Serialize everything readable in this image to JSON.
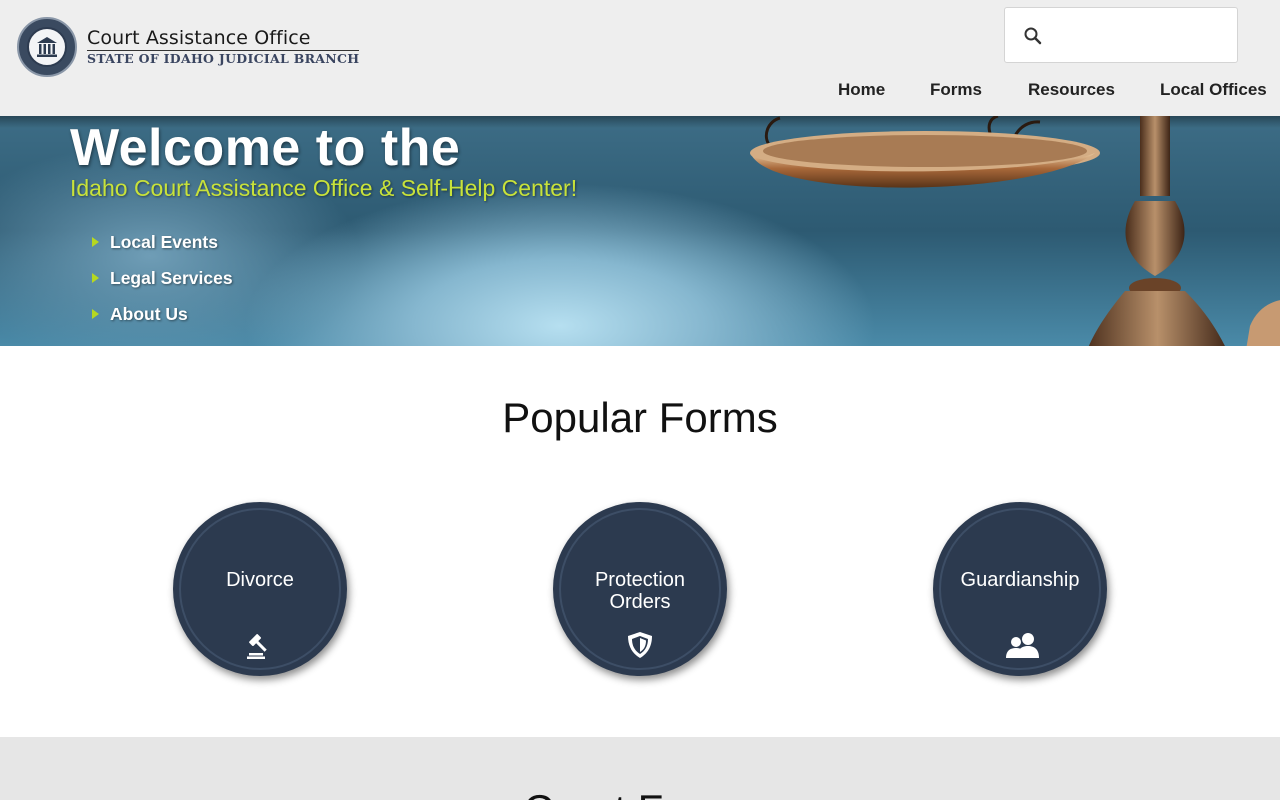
{
  "header": {
    "logo_title": "Court Assistance Office",
    "logo_subtitle": "STATE OF IDAHO JUDICIAL BRANCH",
    "search_placeholder": "",
    "nav": [
      {
        "label": "Home"
      },
      {
        "label": "Forms"
      },
      {
        "label": "Resources"
      },
      {
        "label": "Local Offices"
      }
    ]
  },
  "hero": {
    "title": "Welcome to the",
    "subtitle": "Idaho Court Assistance Office & Self-Help Center!",
    "links": [
      {
        "label": "Local Events"
      },
      {
        "label": "Legal Services"
      },
      {
        "label": "About Us"
      }
    ]
  },
  "popular": {
    "title": "Popular Forms",
    "items": [
      {
        "label": "Divorce",
        "icon": "gavel-icon"
      },
      {
        "label": "Protection Orders",
        "icon": "shield-icon"
      },
      {
        "label": "Guardianship",
        "icon": "people-icon"
      }
    ]
  },
  "bottom": {
    "title": "Court Forms"
  },
  "colors": {
    "header_bg": "#eeeeee",
    "circle_bg": "#2c3a4f",
    "hero_subtitle": "#c8e23a",
    "bottom_bg": "#e6e6e6"
  }
}
